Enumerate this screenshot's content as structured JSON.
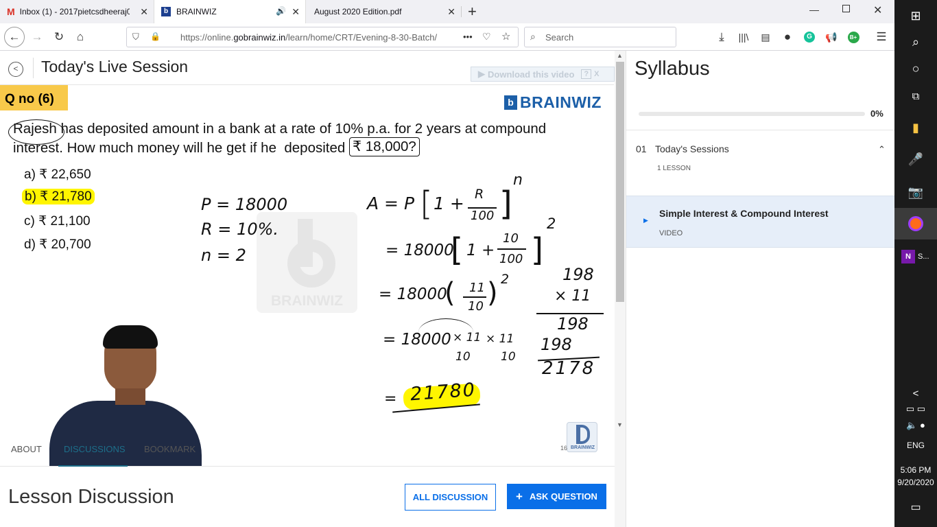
{
  "browser": {
    "tabs": [
      {
        "label": "Inbox (1) - 2017pietcsdheeraj0",
        "icon": "gmail-icon"
      },
      {
        "label": "BRAINWIZ",
        "icon": "brainwiz-favicon",
        "audio": "speaker-icon"
      },
      {
        "label": "August 2020 Edition.pdf"
      }
    ],
    "new_tab": "+",
    "url_prefix": "https://online.",
    "url_domain": "gobrainwiz.in",
    "url_path": "/learn/home/CRT/Evening-8-30-Batch/",
    "url_more": "•••",
    "search_placeholder": "Search",
    "ext_b_badge": "B+"
  },
  "header": {
    "title": "Today's Live Session",
    "download_label": "Download this video",
    "download_help": "?",
    "download_close": "X"
  },
  "question": {
    "number_label": "Q no (6)",
    "brand": "BRAINWIZ",
    "text_line1": "Rajesh has deposited amount in a bank at a rate of 10% p.a. for 2 years at compound",
    "text_line2a": "interest. How much money will he get if he  deposited ",
    "text_line2b": "₹ 18,000?",
    "options": [
      {
        "label": "a)  ₹ 22,650",
        "highlight": false
      },
      {
        "label": "b) ₹ 21,780",
        "highlight": true
      },
      {
        "label": "c) ₹ 21,100",
        "highlight": false
      },
      {
        "label": "d) ₹ 20,700",
        "highlight": false
      }
    ],
    "watermark": "BRAINWIZ",
    "corner_logo_text": "BRAINWIZ",
    "slide_number": "16"
  },
  "handwriting": {
    "given_p": "P = 18000",
    "given_r": "R  =  10%.",
    "given_n": "n = 2",
    "formula_lhs": "A = P",
    "formula_inner": "1 +",
    "formula_num": "R",
    "formula_den": "100",
    "formula_exp": "n",
    "step1_lhs": "= 18000",
    "step1_inner": "1 +",
    "step1_num": "10",
    "step1_den": "100",
    "step1_exp": "2",
    "step2_lhs": "= 18000",
    "step2_num": "11",
    "step2_den": "10",
    "step2_exp": "2",
    "step3_lhs": "= 18000",
    "step3_mul1": "× 11",
    "step3_den1": "10",
    "step3_mul2": "× 11",
    "step3_den2": "10",
    "result_eq": "=",
    "result": "21780",
    "calc_line1": "198",
    "calc_line2": "× 11",
    "calc_line3": "198",
    "calc_line4": "198",
    "calc_line5": "2178"
  },
  "tabs": {
    "items": [
      "ABOUT",
      "DISCUSSIONS",
      "BOOKMARK"
    ],
    "active": "DISCUSSIONS"
  },
  "discussion": {
    "title": "Lesson Discussion",
    "all_button": "ALL DISCUSSION",
    "ask_button": "ASK QUESTION",
    "ask_icon": "+"
  },
  "syllabus": {
    "title": "Syllabus",
    "progress": 0,
    "progress_label": "0%",
    "section_number": "01",
    "section_title": "Today's Sessions",
    "section_count": "1 LESSON",
    "lesson_title": "Simple Interest & Compound Interest",
    "lesson_type": "VIDEO"
  },
  "taskbar": {
    "onenote_label": "S...",
    "language": "ENG",
    "time": "5:06 PM",
    "date": "9/20/2020"
  },
  "colors": {
    "accent_blue": "#0a6fe8",
    "brand_blue": "#1c5fa8",
    "highlight_yellow": "#fff500",
    "qno_yellow": "#f8c94a",
    "selected_lesson_bg": "#e6eef9"
  }
}
